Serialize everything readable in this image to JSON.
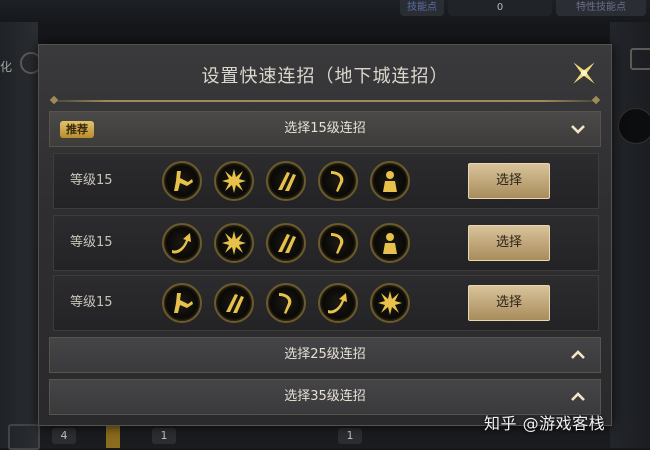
{
  "background": {
    "top_pills": [
      "技能点",
      "0",
      "特性技能点"
    ],
    "left_text": "化",
    "bottom_numbers": [
      "4",
      "1",
      "1"
    ]
  },
  "dialog": {
    "title": "设置快速连招（地下城连招）",
    "close_icon": "sparkle-close-icon"
  },
  "sections": [
    {
      "label": "选择15级连招",
      "badge": "推荐",
      "expanded": true,
      "chevron": "chevron-down-icon"
    },
    {
      "label": "选择25级连招",
      "expanded": false,
      "chevron": "chevron-up-icon"
    },
    {
      "label": "选择35级连招",
      "expanded": false,
      "chevron": "chevron-up-icon"
    }
  ],
  "combos": [
    {
      "level_label": "等级15",
      "button_label": "选择",
      "skills": [
        "kick-skill-icon",
        "burst-skill-icon",
        "slash-skill-icon",
        "claw-skill-icon",
        "fighter-skill-icon"
      ]
    },
    {
      "level_label": "等级15",
      "button_label": "选择",
      "skills": [
        "uppercut-skill-icon",
        "burst-skill-icon",
        "slash-skill-icon",
        "claw-skill-icon",
        "fighter-skill-icon"
      ]
    },
    {
      "level_label": "等级15",
      "button_label": "选择",
      "skills": [
        "kick-skill-icon",
        "slash-skill-icon",
        "claw-skill-icon",
        "uppercut-skill-icon",
        "burst-skill-icon"
      ]
    }
  ],
  "watermark": "知乎 @游戏客栈",
  "colors": {
    "gold": "#e8c14a",
    "button": "#c9b088",
    "badge": "#d4b05a"
  }
}
